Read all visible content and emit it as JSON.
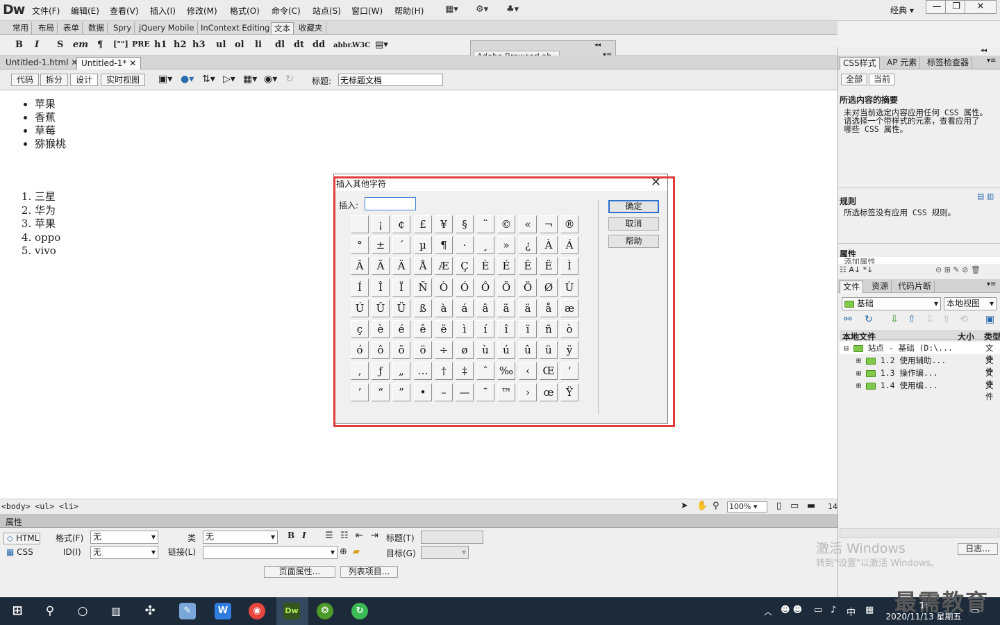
{
  "app": {
    "logo": "Dw",
    "workspace": "经典"
  },
  "menu": [
    "文件(F)",
    "编辑(E)",
    "查看(V)",
    "插入(I)",
    "修改(M)",
    "格式(O)",
    "命令(C)",
    "站点(S)",
    "窗口(W)",
    "帮助(H)"
  ],
  "insert_tabs": [
    "常用",
    "布局",
    "表单",
    "数据",
    "Spry",
    "jQuery Mobile",
    "InContext Editing",
    "文本",
    "收藏夹"
  ],
  "insert_active_tab": "文本",
  "format_buttons": [
    "B",
    "I",
    "S",
    "em",
    "¶",
    "[\"\"]",
    "PRE",
    "h1",
    "h2",
    "h3",
    "ul",
    "ol",
    "li",
    "dl",
    "dt",
    "dd",
    "abbr.",
    "W3C"
  ],
  "browserlab": "Adobe BrowserLab",
  "doc_tabs": [
    "Untitled-1.html",
    "Untitled-1*"
  ],
  "view_buttons": [
    "代码",
    "拆分",
    "设计",
    "实时视图"
  ],
  "doc_title_label": "标题:",
  "doc_title_value": "无标题文档",
  "ul_items": [
    "苹果",
    "香蕉",
    "草莓",
    "猕猴桃"
  ],
  "ol_items": [
    "三星",
    "华为",
    "苹果",
    "oppo",
    "vivo"
  ],
  "dialog": {
    "title": "插入其他字符",
    "insert_label": "插入:",
    "ok": "确定",
    "cancel": "取消",
    "help": "帮助",
    "rows": [
      [
        " ",
        "¡",
        "¢",
        "£",
        "¥",
        "§",
        "¨",
        "©",
        "«",
        "¬",
        "®"
      ],
      [
        "°",
        "±",
        "´",
        "µ",
        "¶",
        "·",
        "¸",
        "»",
        "¿",
        "À",
        "Á"
      ],
      [
        "Â",
        "Ã",
        "Ä",
        "Å",
        "Æ",
        "Ç",
        "È",
        "É",
        "Ê",
        "Ë",
        "Ì"
      ],
      [
        "Í",
        "Î",
        "Ï",
        "Ñ",
        "Ò",
        "Ó",
        "Ô",
        "Õ",
        "Ö",
        "Ø",
        "Ù"
      ],
      [
        "Ú",
        "Û",
        "Ü",
        "ß",
        "à",
        "á",
        "â",
        "ã",
        "ä",
        "å",
        "æ"
      ],
      [
        "ç",
        "è",
        "é",
        "ê",
        "ë",
        "ì",
        "í",
        "î",
        "ï",
        "ñ",
        "ò"
      ],
      [
        "ó",
        "ô",
        "õ",
        "ö",
        "÷",
        "ø",
        "ù",
        "ú",
        "û",
        "ü",
        "ÿ"
      ],
      [
        "‚",
        "ƒ",
        "„",
        "…",
        "†",
        "‡",
        "ˆ",
        "‰",
        "‹",
        "Œ",
        "‘"
      ],
      [
        "’",
        "“",
        "”",
        "•",
        "–",
        "—",
        "˜",
        "™",
        "›",
        "œ",
        "Ÿ"
      ]
    ]
  },
  "status": {
    "tag_selector": "<body> <ul> <li>",
    "zoom": "100%",
    "size_hint": "14"
  },
  "props": {
    "header": "属性",
    "html_btn": "HTML",
    "css_btn": "CSS",
    "format_label": "格式(F)",
    "format_value": "无",
    "id_label": "ID(I)",
    "id_value": "无",
    "class_label": "类",
    "class_value": "无",
    "link_label": "链接(L)",
    "title_label": "标题(T)",
    "target_label": "目标(G)",
    "page_props": "页面属性...",
    "list_item": "列表项目..."
  },
  "right": {
    "css_tabs": [
      "CSS样式",
      "AP 元素",
      "标签检查器"
    ],
    "mode_tabs": [
      "全部",
      "当前"
    ],
    "summary_head": "所选内容的摘要",
    "summary_text": [
      "未对当前选定内容应用任何 CSS 属性。",
      "请选择一个带样式的元素，查看应用了",
      "哪些 CSS 属性。"
    ],
    "rules_head": "规则",
    "rules_text": "所选标签没有应用 CSS 规则。",
    "props_head": "属性",
    "props_add": "添加属性",
    "file_tabs": [
      "文件",
      "资源",
      "代码片断"
    ],
    "site": "基础",
    "view": "本地视图",
    "col_local": "本地文件",
    "col_size": "大小",
    "col_type": "类型",
    "tree": [
      {
        "label": "站点 - 基础 (D:\\...",
        "type": "文件"
      },
      {
        "label": "1.2  使用辅助...",
        "type": "文件"
      },
      {
        "label": "1.3   操作编...",
        "type": "文件"
      },
      {
        "label": "1.4   使用编...",
        "type": "文件"
      }
    ],
    "log_btn": "日志..."
  },
  "watermark": {
    "line1": "激活 Windows",
    "line2": "转到\"设置\"以激活 Windows。"
  },
  "clock": {
    "time": "1:",
    "date": "2020/11/13 星期五"
  },
  "ime": "中",
  "brand": "最需教育",
  "taskbar_icons": [
    "windows-start",
    "search",
    "cortana",
    "task-view",
    "pinwheel",
    "notepad",
    "word",
    "chrome",
    "dreamweaver",
    "watermelon",
    "refresh-app"
  ]
}
